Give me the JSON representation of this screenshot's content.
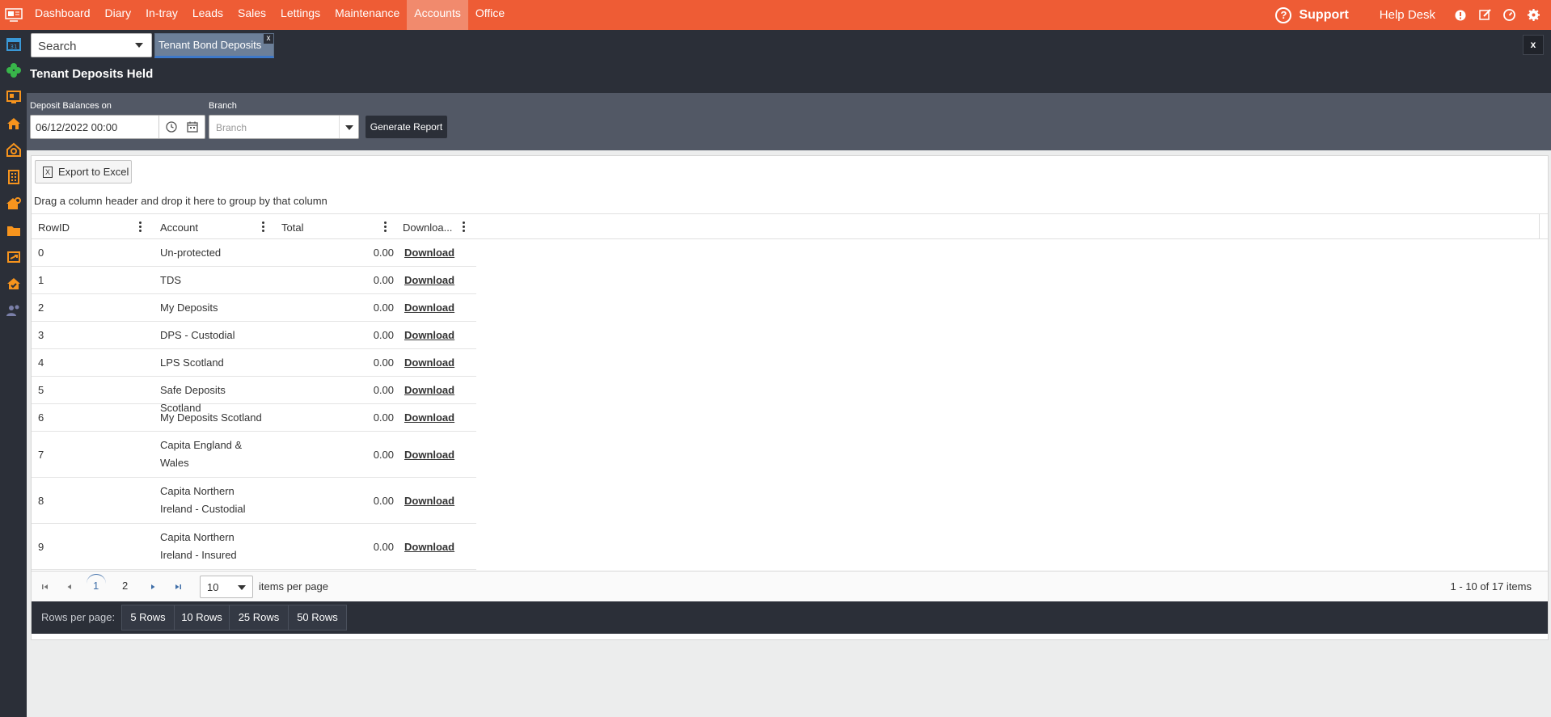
{
  "nav": {
    "items": [
      "Dashboard",
      "Diary",
      "In-tray",
      "Leads",
      "Sales",
      "Lettings",
      "Maintenance",
      "Accounts",
      "Office"
    ],
    "active": "Accounts",
    "support": "Support",
    "help_desk": "Help Desk"
  },
  "header": {
    "search_label": "Search",
    "tab_label": "Tenant Bond Deposits",
    "tab_close": "x",
    "close_label": "x",
    "page_title": "Tenant Deposits Held"
  },
  "filters": {
    "date_label": "Deposit Balances on",
    "date_value": "06/12/2022 00:00",
    "branch_label": "Branch",
    "branch_placeholder": "Branch",
    "generate_label": "Generate Report"
  },
  "grid": {
    "export_label": "Export to Excel",
    "group_hint": "Drag a column header and drop it here to group by that column",
    "columns": [
      "RowID",
      "Account",
      "Total",
      "Downloa..."
    ],
    "rows": [
      {
        "id": "0",
        "account": "Un-protected",
        "total": "0.00",
        "download": "Download"
      },
      {
        "id": "1",
        "account": "TDS",
        "total": "0.00",
        "download": "Download"
      },
      {
        "id": "2",
        "account": "My Deposits",
        "total": "0.00",
        "download": "Download"
      },
      {
        "id": "3",
        "account": "DPS - Custodial",
        "total": "0.00",
        "download": "Download"
      },
      {
        "id": "4",
        "account": "LPS Scotland",
        "total": "0.00",
        "download": "Download"
      },
      {
        "id": "5",
        "account": "Safe Deposits Scotland",
        "total": "0.00",
        "download": "Download"
      },
      {
        "id": "6",
        "account": "My Deposits Scotland",
        "total": "0.00",
        "download": "Download"
      },
      {
        "id": "7",
        "account": "Capita England & Wales",
        "total": "0.00",
        "download": "Download"
      },
      {
        "id": "8",
        "account": "Capita Northern Ireland - Custodial",
        "total": "0.00",
        "download": "Download"
      },
      {
        "id": "9",
        "account": "Capita Northern Ireland - Insured",
        "total": "0.00",
        "download": "Download"
      }
    ]
  },
  "pager": {
    "pages": [
      "1",
      "2"
    ],
    "current_page": "1",
    "page_size": "10",
    "items_per_page": "items per page",
    "info": "1 - 10 of 17 items"
  },
  "rows_per_page": {
    "label": "Rows per page:",
    "options": [
      "5 Rows",
      "10 Rows",
      "25 Rows",
      "50 Rows"
    ]
  },
  "colors": {
    "topbar": "#ee5c35",
    "dark": "#2b2f38",
    "filterbar": "#525865",
    "sidebar_icon": "#f7941d"
  },
  "icons": {
    "sidebar": [
      "calendar-icon",
      "clover-icon",
      "monitor-icon",
      "house-icon",
      "house-search-icon",
      "building-icon",
      "house-key-icon",
      "folder-icon",
      "transfer-icon",
      "house-check-icon",
      "user-group-icon"
    ]
  }
}
